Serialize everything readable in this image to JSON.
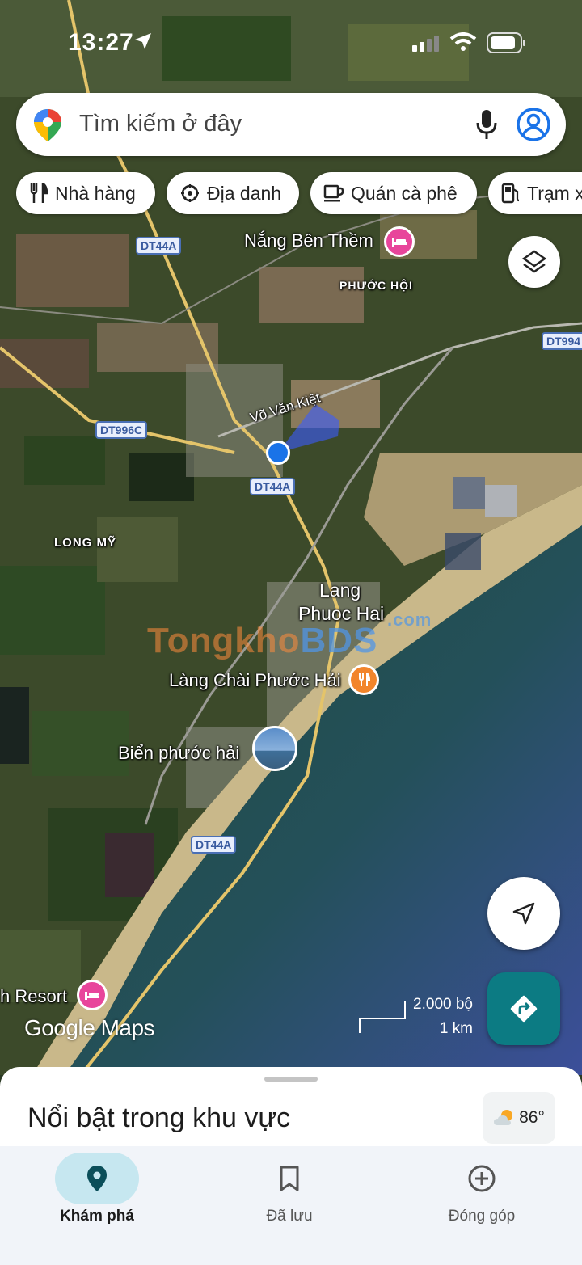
{
  "status_bar": {
    "time": "13:27"
  },
  "search": {
    "placeholder": "Tìm kiếm ở đây"
  },
  "chips": [
    {
      "label": "Nhà hàng",
      "icon": "restaurant-icon"
    },
    {
      "label": "Địa danh",
      "icon": "landmark-icon"
    },
    {
      "label": "Quán cà phê",
      "icon": "coffee-icon"
    },
    {
      "label": "Trạm x",
      "icon": "gas-station-icon"
    }
  ],
  "map": {
    "road_shields": [
      "DT44A",
      "DT996C",
      "DT44A",
      "DT44A",
      "DT994"
    ],
    "places": {
      "nang_ben_them": "Nắng Bên Thềm",
      "phuoc_hoi": "PHƯỚC HỘI",
      "vo_van_kiet": "Võ Văn Kiệt",
      "long_my": "LONG MỸ",
      "lang_phuoc_hai_1": "Lang",
      "lang_phuoc_hai_2": "Phuoc Hai",
      "lang_chai": "Làng Chài Phước Hải",
      "bien_phuoc_hai": "Biển phước hải",
      "resort": "h Resort"
    },
    "watermark": {
      "tong": "Tongkho",
      "bds": "BDS",
      "com": ".com"
    },
    "scale": {
      "feet": "2.000 bộ",
      "km": "1 km"
    },
    "brand": "Google Maps",
    "colors": {
      "current_location": "#1a73e8",
      "hotel_pin": "#e8459b",
      "restaurant_pin": "#f2852b",
      "directions_button": "#0c7b83"
    }
  },
  "sheet": {
    "title": "Nổi bật trong khu vực",
    "weather": "86°"
  },
  "nav": [
    {
      "label": "Khám phá",
      "icon": "explore-pin-icon",
      "active": true
    },
    {
      "label": "Đã lưu",
      "icon": "bookmark-icon",
      "active": false
    },
    {
      "label": "Đóng góp",
      "icon": "add-circle-icon",
      "active": false
    }
  ]
}
